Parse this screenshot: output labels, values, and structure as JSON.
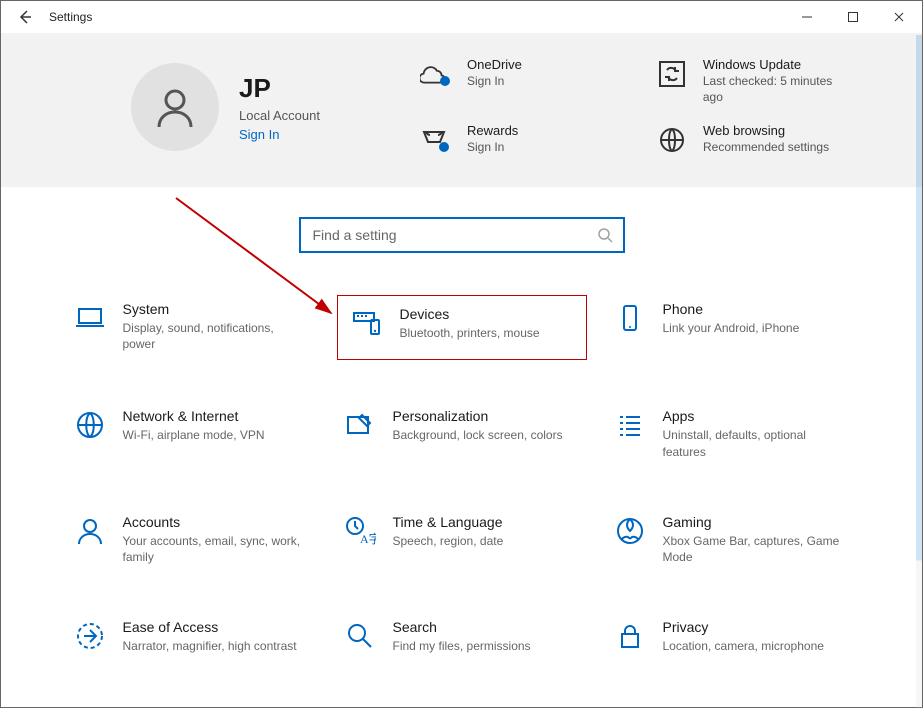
{
  "window": {
    "title": "Settings"
  },
  "user": {
    "name": "JP",
    "account_type": "Local Account",
    "sign_in_label": "Sign In"
  },
  "header_cards": {
    "onedrive": {
      "title": "OneDrive",
      "sub": "Sign In"
    },
    "rewards": {
      "title": "Rewards",
      "sub": "Sign In"
    },
    "update": {
      "title": "Windows Update",
      "sub": "Last checked: 5 minutes ago"
    },
    "web": {
      "title": "Web browsing",
      "sub": "Recommended settings"
    }
  },
  "search": {
    "placeholder": "Find a setting"
  },
  "categories": {
    "system": {
      "title": "System",
      "desc": "Display, sound, notifications, power"
    },
    "devices": {
      "title": "Devices",
      "desc": "Bluetooth, printers, mouse"
    },
    "phone": {
      "title": "Phone",
      "desc": "Link your Android, iPhone"
    },
    "network": {
      "title": "Network & Internet",
      "desc": "Wi-Fi, airplane mode, VPN"
    },
    "personalization": {
      "title": "Personalization",
      "desc": "Background, lock screen, colors"
    },
    "apps": {
      "title": "Apps",
      "desc": "Uninstall, defaults, optional features"
    },
    "accounts": {
      "title": "Accounts",
      "desc": "Your accounts, email, sync, work, family"
    },
    "time": {
      "title": "Time & Language",
      "desc": "Speech, region, date"
    },
    "gaming": {
      "title": "Gaming",
      "desc": "Xbox Game Bar, captures, Game Mode"
    },
    "ease": {
      "title": "Ease of Access",
      "desc": "Narrator, magnifier, high contrast"
    },
    "search_cat": {
      "title": "Search",
      "desc": "Find my files, permissions"
    },
    "privacy": {
      "title": "Privacy",
      "desc": "Location, camera, microphone"
    }
  },
  "highlighted_category": "devices"
}
